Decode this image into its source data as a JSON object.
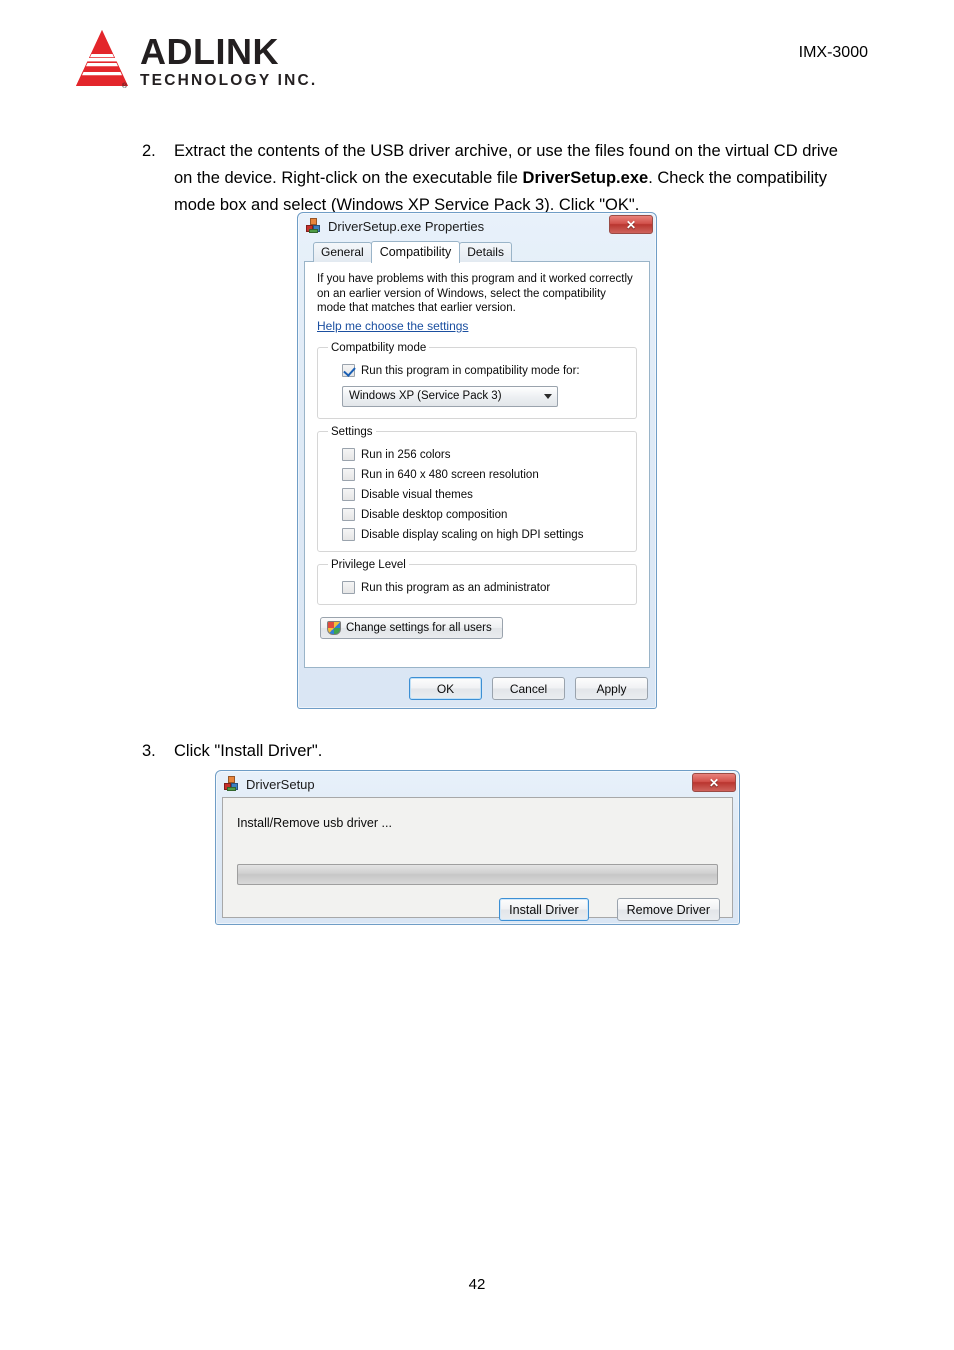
{
  "header": {
    "logo_word": "ADLINK",
    "logo_sub": "TECHNOLOGY INC.",
    "logo_icon": "adlink-triangle-logo",
    "model": "IMX-3000"
  },
  "steps": [
    {
      "number": "2.",
      "text_before_bold": "Extract the contents of the USB driver archive, or use the files found on the virtual CD drive on the device. Right-click on the executable file ",
      "bold": "DriverSetup.exe",
      "text_after_bold": ". Check the compatibility mode box and select (Windows XP Service Pack 3). Click \"OK\"."
    },
    {
      "number": "3.",
      "text": "Click \"Install Driver\"."
    }
  ],
  "properties_dialog": {
    "title": "DriverSetup.exe Properties",
    "title_icon": "app-blocks-icon",
    "close_label": "✕",
    "tabs": [
      {
        "label": "General",
        "active": false
      },
      {
        "label": "Compatibility",
        "active": true
      },
      {
        "label": "Details",
        "active": false
      }
    ],
    "intro": "If you have problems with this program and it worked correctly on an earlier version of Windows, select the compatibility mode that matches that earlier version.",
    "help_link": "Help me choose the settings",
    "compat_group": {
      "legend": "Compatbility mode",
      "checkbox_label": "Run this program in compatibility mode for:",
      "checkbox_checked": true,
      "combo_value": "Windows XP (Service Pack 3)"
    },
    "settings_group": {
      "legend": "Settings",
      "items": [
        {
          "label": "Run in 256 colors",
          "checked": false
        },
        {
          "label": "Run in 640 x 480 screen resolution",
          "checked": false
        },
        {
          "label": "Disable visual themes",
          "checked": false
        },
        {
          "label": "Disable desktop composition",
          "checked": false
        },
        {
          "label": "Disable display scaling on high DPI settings",
          "checked": false
        }
      ]
    },
    "privilege_group": {
      "legend": "Privilege Level",
      "items": [
        {
          "label": "Run this program as an administrator",
          "checked": false
        }
      ]
    },
    "change_all_users_button": "Change settings for all users",
    "buttons": [
      {
        "label": "OK",
        "default": true
      },
      {
        "label": "Cancel",
        "default": false
      },
      {
        "label": "Apply",
        "default": false
      }
    ]
  },
  "setup_dialog": {
    "title": "DriverSetup",
    "title_icon": "app-blocks-icon",
    "close_label": "✕",
    "status": "Install/Remove usb driver ...",
    "progress_percent": 0,
    "buttons": [
      {
        "label": "Install Driver",
        "default": true
      },
      {
        "label": "Remove Driver",
        "default": false
      }
    ]
  },
  "footer": {
    "page_number": "42"
  },
  "colors": {
    "brand_red": "#e3262b",
    "brand_dark": "#231f20",
    "link": "#1b4fa0",
    "title_bar": "#dfeaf6",
    "close_red": "#c7312b"
  }
}
